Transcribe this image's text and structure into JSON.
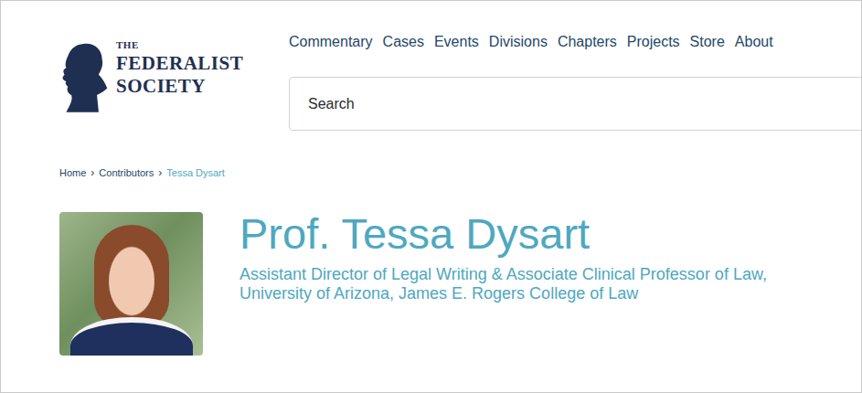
{
  "logo": {
    "lines": [
      "THE",
      "FEDERALIST",
      "SOCIETY"
    ]
  },
  "nav": {
    "items": [
      "Commentary",
      "Cases",
      "Events",
      "Divisions",
      "Chapters",
      "Projects",
      "Store",
      "About"
    ]
  },
  "search": {
    "placeholder": "Search"
  },
  "breadcrumb": {
    "separator": "›",
    "items": [
      {
        "label": "Home",
        "current": false
      },
      {
        "label": "Contributors",
        "current": false
      },
      {
        "label": "Tessa Dysart",
        "current": true
      }
    ]
  },
  "profile": {
    "name": "Prof. Tessa Dysart",
    "title": "Assistant Director of Legal Writing & Associate Clinical Professor of Law, University of Arizona, James E. Rogers College of Law"
  }
}
